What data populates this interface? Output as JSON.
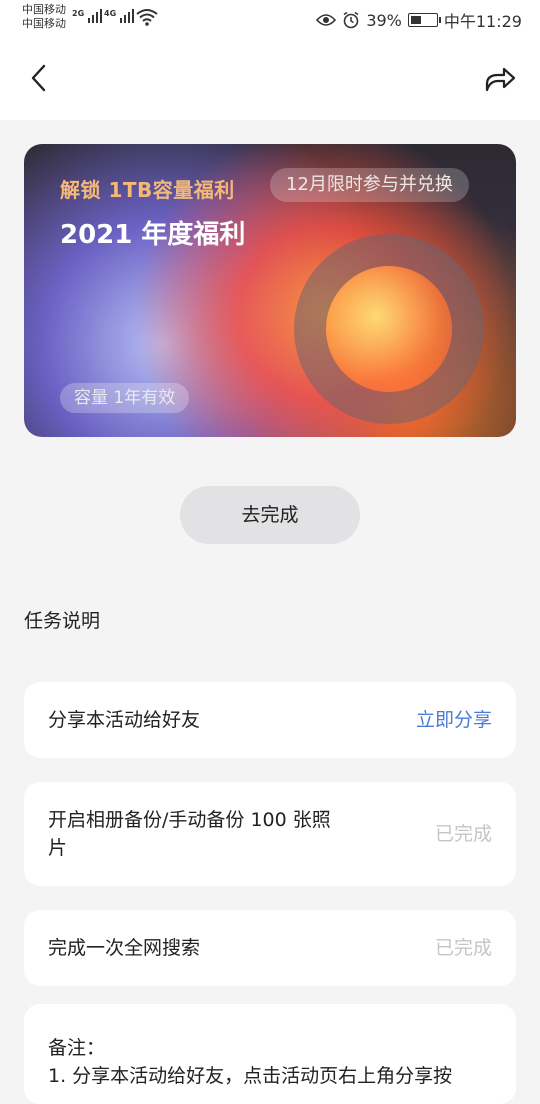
{
  "status_bar": {
    "carrier_1": "中国移动",
    "carrier_2": "中国移动",
    "signal_1_type": "2G",
    "signal_2_type": "4G",
    "battery": "39%",
    "time": "中午11:29"
  },
  "banner": {
    "subtitle": "解锁 1TB容量福利",
    "tag": "12月限时参与并兑换",
    "title": "2021 年度福利",
    "chip": "容量 1年有效"
  },
  "primary_button": {
    "label": "去完成"
  },
  "section": {
    "title": "任务说明"
  },
  "tasks": [
    {
      "label": "分享本活动给好友",
      "action": "立即分享",
      "status": "link"
    },
    {
      "label_line1": "开启相册备份/手动备份 100 张照",
      "label_line2": "片",
      "action": "已完成",
      "status": "done"
    },
    {
      "label": "完成一次全网搜索",
      "action": "已完成",
      "status": "done"
    }
  ],
  "note": {
    "line1": "备注：",
    "line2": "1. 分享本活动给好友，点击活动页右上角分享按"
  },
  "colors": {
    "link": "#4a7cd8",
    "done": "#c6c6c6",
    "banner_subtitle": "#f5b878"
  }
}
